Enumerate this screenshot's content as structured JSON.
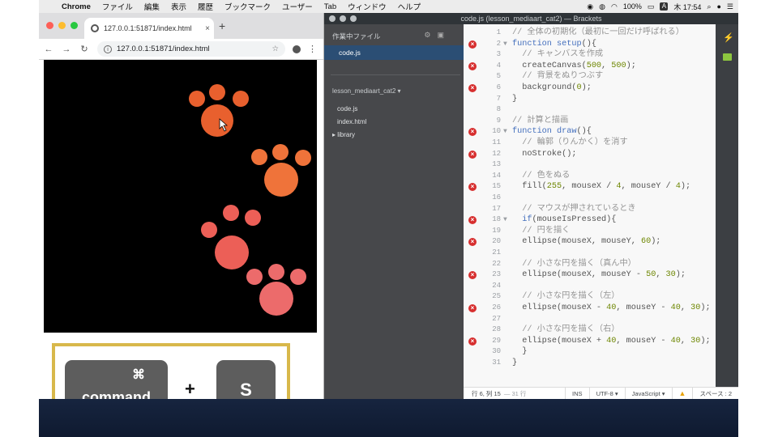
{
  "menubar": {
    "apple": "",
    "items": [
      "Chrome",
      "ファイル",
      "編集",
      "表示",
      "履歴",
      "ブックマーク",
      "ユーザー",
      "Tab",
      "ウィンドウ",
      "ヘルプ"
    ],
    "battery": "100%",
    "input_badge": "A",
    "clock": "木 17:54"
  },
  "chrome": {
    "tab_title": "127.0.0.1:51871/index.html",
    "tab_close": "×",
    "new_tab": "+",
    "nav_back": "←",
    "nav_forward": "→",
    "nav_reload": "↻",
    "url": "127.0.0.1:51871/index.html",
    "info": "i",
    "star": "☆",
    "menu": "⋮"
  },
  "overlay": {
    "command_symbol": "⌘",
    "command_label": "command",
    "plus": "+",
    "key_s": "S"
  },
  "colors": {
    "paw_1": "#e8602e",
    "paw_2": "#ef733a",
    "paw_3": "#ec5f57",
    "paw_4": "#ec6b6b"
  },
  "brackets": {
    "window_title": "code.js (lesson_mediaart_cat2) — Brackets",
    "working_files_label": "作業中ファイル",
    "working_file": "code.js",
    "project_name": "lesson_mediaart_cat2",
    "files": [
      "code.js",
      "index.html",
      "library"
    ],
    "folder_arrow": "▸",
    "project_arrow": "▾",
    "code_lines": [
      {
        "n": "1",
        "err": false,
        "fold": "",
        "parts": [
          [
            "cm",
            "// 全体の初期化（最初に一回だけ呼ばれる）"
          ]
        ]
      },
      {
        "n": "2",
        "err": true,
        "fold": "▼",
        "parts": [
          [
            "kw",
            "function "
          ],
          [
            "kw",
            "setup"
          ],
          [
            "tx",
            "(){"
          ]
        ]
      },
      {
        "n": "3",
        "err": false,
        "fold": "",
        "parts": [
          [
            "tx",
            "  "
          ],
          [
            "cm",
            "// キャンバスを作成"
          ]
        ]
      },
      {
        "n": "4",
        "err": true,
        "fold": "",
        "parts": [
          [
            "tx",
            "  createCanvas("
          ],
          [
            "nm",
            "500"
          ],
          [
            "tx",
            ", "
          ],
          [
            "nm",
            "500"
          ],
          [
            "tx",
            ");"
          ]
        ]
      },
      {
        "n": "5",
        "err": false,
        "fold": "",
        "parts": [
          [
            "tx",
            "  "
          ],
          [
            "cm",
            "// 背景をぬりつぶす"
          ]
        ]
      },
      {
        "n": "6",
        "err": true,
        "fold": "",
        "parts": [
          [
            "tx",
            "  background("
          ],
          [
            "nm",
            "0"
          ],
          [
            "tx",
            ");"
          ]
        ]
      },
      {
        "n": "7",
        "err": false,
        "fold": "",
        "parts": [
          [
            "tx",
            "}"
          ]
        ]
      },
      {
        "n": "8",
        "err": false,
        "fold": "",
        "parts": []
      },
      {
        "n": "9",
        "err": false,
        "fold": "",
        "parts": [
          [
            "cm",
            "// 計算と描画"
          ]
        ]
      },
      {
        "n": "10",
        "err": true,
        "fold": "▼",
        "parts": [
          [
            "kw",
            "function "
          ],
          [
            "kw",
            "draw"
          ],
          [
            "tx",
            "(){"
          ]
        ]
      },
      {
        "n": "11",
        "err": false,
        "fold": "",
        "parts": [
          [
            "tx",
            "  "
          ],
          [
            "cm",
            "// 輪郭（りんかく）を消す"
          ]
        ]
      },
      {
        "n": "12",
        "err": true,
        "fold": "",
        "parts": [
          [
            "tx",
            "  noStroke();"
          ]
        ]
      },
      {
        "n": "13",
        "err": false,
        "fold": "",
        "parts": []
      },
      {
        "n": "14",
        "err": false,
        "fold": "",
        "parts": [
          [
            "tx",
            "  "
          ],
          [
            "cm",
            "// 色をぬる"
          ]
        ]
      },
      {
        "n": "15",
        "err": true,
        "fold": "",
        "parts": [
          [
            "tx",
            "  fill("
          ],
          [
            "nm",
            "255"
          ],
          [
            "tx",
            ", mouseX / "
          ],
          [
            "nm",
            "4"
          ],
          [
            "tx",
            ", mouseY / "
          ],
          [
            "nm",
            "4"
          ],
          [
            "tx",
            ");"
          ]
        ]
      },
      {
        "n": "16",
        "err": false,
        "fold": "",
        "parts": []
      },
      {
        "n": "17",
        "err": false,
        "fold": "",
        "parts": [
          [
            "tx",
            "  "
          ],
          [
            "cm",
            "// マウスが押されているとき"
          ]
        ]
      },
      {
        "n": "18",
        "err": true,
        "fold": "▼",
        "parts": [
          [
            "tx",
            "  "
          ],
          [
            "kw",
            "if"
          ],
          [
            "tx",
            "(mouseIsPressed){"
          ]
        ]
      },
      {
        "n": "19",
        "err": false,
        "fold": "",
        "parts": [
          [
            "tx",
            "  "
          ],
          [
            "cm",
            "// 円を描く"
          ]
        ]
      },
      {
        "n": "20",
        "err": true,
        "fold": "",
        "parts": [
          [
            "tx",
            "  ellipse(mouseX, mouseY, "
          ],
          [
            "nm",
            "60"
          ],
          [
            "tx",
            ");"
          ]
        ]
      },
      {
        "n": "21",
        "err": false,
        "fold": "",
        "parts": []
      },
      {
        "n": "22",
        "err": false,
        "fold": "",
        "parts": [
          [
            "tx",
            "  "
          ],
          [
            "cm",
            "// 小さな円を描く（真ん中）"
          ]
        ]
      },
      {
        "n": "23",
        "err": true,
        "fold": "",
        "parts": [
          [
            "tx",
            "  ellipse(mouseX, mouseY - "
          ],
          [
            "nm",
            "50"
          ],
          [
            "tx",
            ", "
          ],
          [
            "nm",
            "30"
          ],
          [
            "tx",
            ");"
          ]
        ]
      },
      {
        "n": "24",
        "err": false,
        "fold": "",
        "parts": []
      },
      {
        "n": "25",
        "err": false,
        "fold": "",
        "parts": [
          [
            "tx",
            "  "
          ],
          [
            "cm",
            "// 小さな円を描く（左）"
          ]
        ]
      },
      {
        "n": "26",
        "err": true,
        "fold": "",
        "parts": [
          [
            "tx",
            "  ellipse(mouseX - "
          ],
          [
            "nm",
            "40"
          ],
          [
            "tx",
            ", mouseY - "
          ],
          [
            "nm",
            "40"
          ],
          [
            "tx",
            ", "
          ],
          [
            "nm",
            "30"
          ],
          [
            "tx",
            ");"
          ]
        ]
      },
      {
        "n": "27",
        "err": false,
        "fold": "",
        "parts": []
      },
      {
        "n": "28",
        "err": false,
        "fold": "",
        "parts": [
          [
            "tx",
            "  "
          ],
          [
            "cm",
            "// 小さな円を描く（右）"
          ]
        ]
      },
      {
        "n": "29",
        "err": true,
        "fold": "",
        "parts": [
          [
            "tx",
            "  ellipse(mouseX + "
          ],
          [
            "nm",
            "40"
          ],
          [
            "tx",
            ", mouseY - "
          ],
          [
            "nm",
            "40"
          ],
          [
            "tx",
            ", "
          ],
          [
            "nm",
            "30"
          ],
          [
            "tx",
            ");"
          ]
        ]
      },
      {
        "n": "30",
        "err": false,
        "fold": "",
        "parts": [
          [
            "tx",
            "  }"
          ]
        ]
      },
      {
        "n": "31",
        "err": false,
        "fold": "",
        "parts": [
          [
            "tx",
            "}"
          ]
        ]
      }
    ],
    "status": {
      "cursor": "行 6, 列 15",
      "line_count": "— 31 行",
      "ins": "INS",
      "encoding": "UTF-8 ▾",
      "language": "JavaScript ▾",
      "warning": "▲",
      "spaces": "スペース : 2"
    }
  }
}
